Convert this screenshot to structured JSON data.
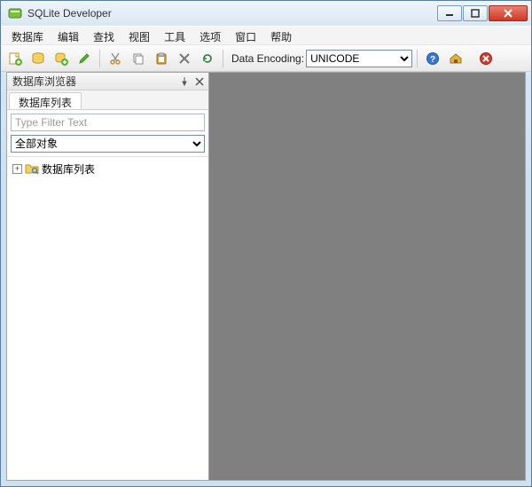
{
  "window": {
    "title": "SQLite Developer"
  },
  "menu": {
    "items": [
      "数据库",
      "编辑",
      "查找",
      "视图",
      "工具",
      "选项",
      "窗口",
      "帮助"
    ]
  },
  "toolbar": {
    "buttons": [
      "new-query",
      "open-database",
      "add-connection",
      "edit",
      "cut",
      "copy",
      "paste",
      "delete",
      "refresh"
    ],
    "encoding_label": "Data Encoding:",
    "encoding_value": "UNICODE",
    "right_buttons": [
      "help-icon",
      "home-icon",
      "stop-icon"
    ]
  },
  "sidebar": {
    "panel_title": "数据库浏览器",
    "tab_label": "数据库列表",
    "filter_placeholder": "Type Filter Text",
    "object_type_value": "全部对象",
    "tree_root_label": "数据库列表"
  }
}
